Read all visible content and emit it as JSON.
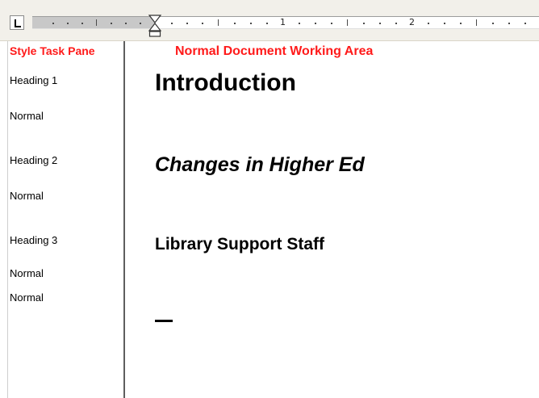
{
  "ruler": {
    "numbers": [
      "1",
      "2"
    ],
    "tab_selector_icon": "left-tab-icon",
    "indent_marker_icon": "indent-marker-icon"
  },
  "captions": {
    "style_pane": "Style Task Pane",
    "document_area": "Normal Document Working Area",
    "color": "#ff1a1a"
  },
  "style_pane": {
    "items": [
      "Heading 1",
      "Normal",
      "Heading 2",
      "Normal",
      "Heading 3",
      "Normal",
      "Normal"
    ]
  },
  "document": {
    "heading1": "Introduction",
    "heading2": "Changes in Higher Ed",
    "heading3": "Library Support Staff"
  }
}
